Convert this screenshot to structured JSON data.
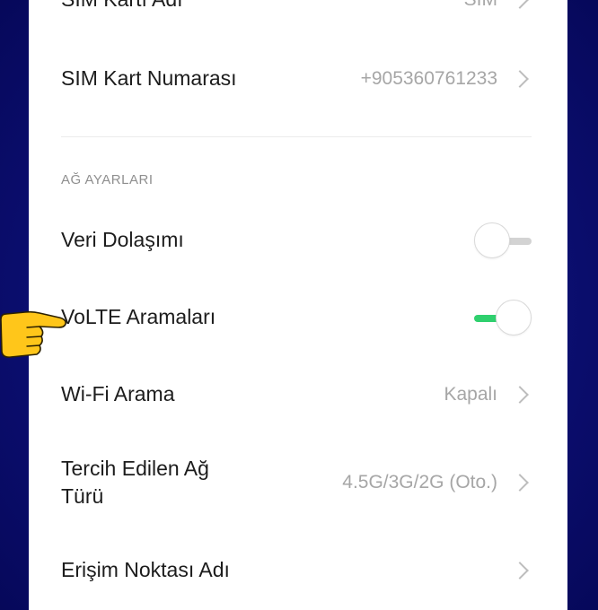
{
  "sim": {
    "name_label": "SIM Kartı Adı",
    "name_value": "SIM",
    "number_label": "SIM Kart Numarası",
    "number_value": "+905360761233"
  },
  "network_section": {
    "header": "AĞ AYARLARI",
    "data_roaming": {
      "label": "Veri Dolaşımı",
      "enabled": false
    },
    "volte": {
      "label": "VoLTE Aramaları",
      "enabled": true
    },
    "wifi_calling": {
      "label": "Wi-Fi Arama",
      "value": "Kapalı"
    },
    "preferred_network": {
      "label_line1": "Tercih Edilen Ağ",
      "label_line2": "Türü",
      "value": "4.5G/3G/2G (Oto.)"
    },
    "apn": {
      "label": "Erişim Noktası Adı"
    }
  },
  "colors": {
    "toggle_on": "#2fd06e",
    "toggle_off": "#d3d3d3",
    "background": "#0c0f73",
    "pointer_hand": "#ffc61a"
  },
  "icons": {
    "chevron": "chevron-right-icon",
    "pointer": "pointing-hand-icon"
  }
}
